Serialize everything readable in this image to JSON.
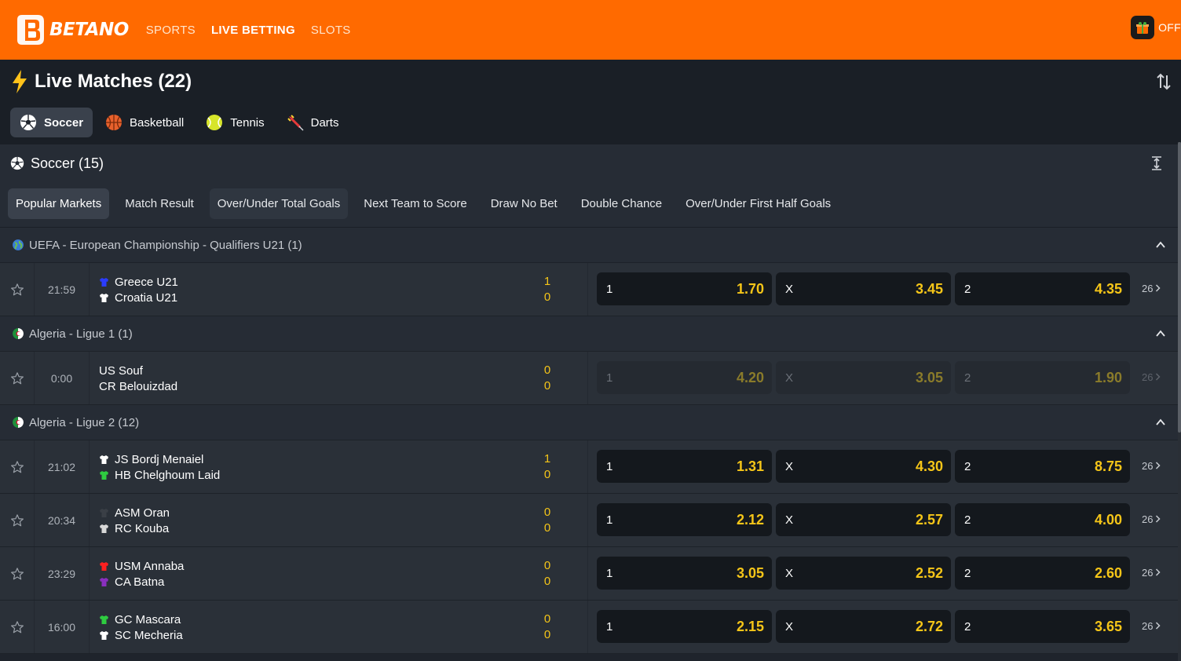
{
  "brand": {
    "name": "BETANO",
    "accent": "#ff6a00",
    "odds_color": "#f5c518"
  },
  "nav": {
    "items": [
      {
        "label": "SPORTS",
        "active": false
      },
      {
        "label": "LIVE BETTING",
        "active": true
      },
      {
        "label": "SLOTS",
        "active": false
      }
    ],
    "offers_label": "OFF",
    "offers_icon": "gift-icon"
  },
  "live": {
    "title": "Live Matches (22)",
    "title_icon": "lightning-icon",
    "sort_icon": "sort-arrows-icon",
    "sport_tabs": [
      {
        "label": "Soccer",
        "icon": "soccer-ball-icon",
        "active": true
      },
      {
        "label": "Basketball",
        "icon": "basketball-icon",
        "active": false
      },
      {
        "label": "Tennis",
        "icon": "tennis-ball-icon",
        "active": false
      },
      {
        "label": "Darts",
        "icon": "dart-icon",
        "active": false
      }
    ]
  },
  "section": {
    "title": "Soccer (15)",
    "market_tabs": [
      {
        "label": "Popular Markets",
        "state": "active"
      },
      {
        "label": "Match Result",
        "state": ""
      },
      {
        "label": "Over/Under Total Goals",
        "state": "highlight"
      },
      {
        "label": "Next Team to Score",
        "state": ""
      },
      {
        "label": "Draw No Bet",
        "state": ""
      },
      {
        "label": "Double Chance",
        "state": ""
      },
      {
        "label": "Over/Under First Half Goals",
        "state": ""
      }
    ]
  },
  "leagues": [
    {
      "name": "UEFA - European Championship - Qualifiers U21 (1)",
      "flag": "globe",
      "matches": [
        {
          "time": "21:59",
          "home": "Greece U21",
          "away": "Croatia U21",
          "home_shirt": "#2b3cff",
          "away_shirt": "#ffffff",
          "home_score": "1",
          "away_score": "0",
          "odds": [
            {
              "label": "1",
              "value": "1.70"
            },
            {
              "label": "X",
              "value": "3.45"
            },
            {
              "label": "2",
              "value": "4.35"
            }
          ],
          "more": "26",
          "suspended": false
        }
      ]
    },
    {
      "name": "Algeria - Ligue 1 (1)",
      "flag": "algeria",
      "matches": [
        {
          "time": "0:00",
          "home": "US Souf",
          "away": "CR Belouizdad",
          "home_shirt": "",
          "away_shirt": "",
          "home_score": "0",
          "away_score": "0",
          "odds": [
            {
              "label": "1",
              "value": "4.20"
            },
            {
              "label": "X",
              "value": "3.05"
            },
            {
              "label": "2",
              "value": "1.90"
            }
          ],
          "more": "26",
          "suspended": true
        }
      ]
    },
    {
      "name": "Algeria - Ligue 2 (12)",
      "flag": "algeria",
      "matches": [
        {
          "time": "21:02",
          "home": "JS Bordj Menaiel",
          "away": "HB Chelghoum Laid",
          "home_shirt": "#ffffff",
          "away_shirt": "#2ecc40",
          "home_score": "1",
          "away_score": "0",
          "odds": [
            {
              "label": "1",
              "value": "1.31"
            },
            {
              "label": "X",
              "value": "4.30"
            },
            {
              "label": "2",
              "value": "8.75"
            }
          ],
          "more": "26",
          "suspended": false
        },
        {
          "time": "20:34",
          "home": "ASM Oran",
          "away": "RC Kouba",
          "home_shirt": "#3a3f46",
          "away_shirt": "#d8d8d8",
          "home_score": "0",
          "away_score": "0",
          "odds": [
            {
              "label": "1",
              "value": "2.12"
            },
            {
              "label": "X",
              "value": "2.57"
            },
            {
              "label": "2",
              "value": "4.00"
            }
          ],
          "more": "26",
          "suspended": false
        },
        {
          "time": "23:29",
          "home": "USM Annaba",
          "away": "CA Batna",
          "home_shirt": "#ff2020",
          "away_shirt": "#8a2fbf",
          "home_score": "0",
          "away_score": "0",
          "odds": [
            {
              "label": "1",
              "value": "3.05"
            },
            {
              "label": "X",
              "value": "2.52"
            },
            {
              "label": "2",
              "value": "2.60"
            }
          ],
          "more": "26",
          "suspended": false
        },
        {
          "time": "16:00",
          "home": "GC Mascara",
          "away": "SC Mecheria",
          "home_shirt": "#2ecc40",
          "away_shirt": "#ffffff",
          "home_score": "0",
          "away_score": "0",
          "odds": [
            {
              "label": "1",
              "value": "2.15"
            },
            {
              "label": "X",
              "value": "2.72"
            },
            {
              "label": "2",
              "value": "3.65"
            }
          ],
          "more": "26",
          "suspended": false
        }
      ]
    }
  ]
}
